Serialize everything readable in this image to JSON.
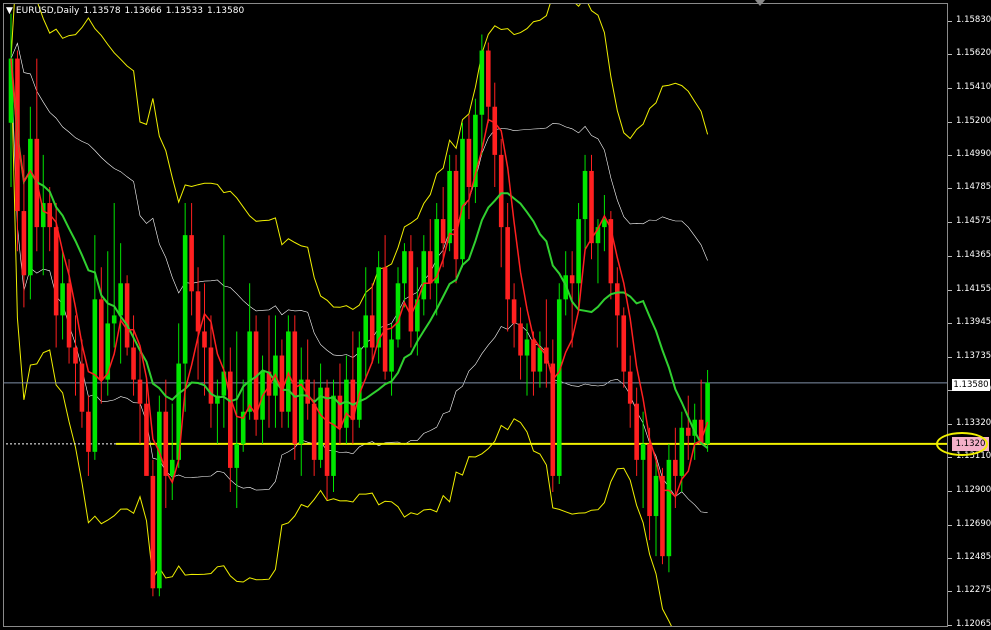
{
  "header": {
    "symbol": "EURUSD,Daily",
    "open": "1.13578",
    "high": "1.13666",
    "low": "1.13533",
    "close": "1.13580"
  },
  "price_axis": {
    "labels": [
      "1.15830",
      "1.15620",
      "1.15410",
      "1.15200",
      "1.14990",
      "1.14785",
      "1.14575",
      "1.14365",
      "1.14155",
      "1.13945",
      "1.13735",
      "1.13530",
      "1.13320",
      "1.13110",
      "1.12900",
      "1.12690",
      "1.12485",
      "1.12275",
      "1.12065"
    ]
  },
  "current_price": "1.13580",
  "horizontal_line_price": "1.1320",
  "colors": {
    "background": "#000000",
    "bull_candle": "#00e600",
    "bear_candle": "#ff2020",
    "bands": "#f0f000",
    "inner_bands": "#ffffff",
    "fast_ma": "#ff2020",
    "slow_ma": "#30d030",
    "horizontal_line": "#f0f000",
    "bid_line": "#8090a8"
  },
  "icons": {
    "menu": "triangle-down-icon",
    "chart_shift": "triangle-down-icon"
  },
  "chart_data": {
    "type": "candlestick",
    "y_range": [
      1.12065,
      1.1594
    ],
    "candles": [
      [
        1.152,
        1.1588,
        1.148,
        1.156
      ],
      [
        1.156,
        1.1565,
        1.144,
        1.1465
      ],
      [
        1.1465,
        1.15,
        1.1405,
        1.1425
      ],
      [
        1.1425,
        1.153,
        1.141,
        1.151
      ],
      [
        1.151,
        1.156,
        1.144,
        1.1455
      ],
      [
        1.1455,
        1.15,
        1.1425,
        1.147
      ],
      [
        1.147,
        1.148,
        1.144,
        1.1455
      ],
      [
        1.1455,
        1.147,
        1.138,
        1.14
      ],
      [
        1.14,
        1.144,
        1.1385,
        1.142
      ],
      [
        1.142,
        1.1435,
        1.137,
        1.138
      ],
      [
        1.138,
        1.14,
        1.135,
        1.137
      ],
      [
        1.137,
        1.1385,
        1.133,
        1.134
      ],
      [
        1.134,
        1.135,
        1.13,
        1.1315
      ],
      [
        1.1315,
        1.145,
        1.131,
        1.141
      ],
      [
        1.141,
        1.143,
        1.1345,
        1.136
      ],
      [
        1.136,
        1.144,
        1.135,
        1.1395
      ],
      [
        1.1395,
        1.147,
        1.138,
        1.14
      ],
      [
        1.14,
        1.1445,
        1.137,
        1.142
      ],
      [
        1.142,
        1.1425,
        1.1375,
        1.138
      ],
      [
        1.138,
        1.14,
        1.135,
        1.136
      ],
      [
        1.136,
        1.138,
        1.132,
        1.1345
      ],
      [
        1.1345,
        1.136,
        1.131,
        1.13
      ],
      [
        1.13,
        1.131,
        1.1225,
        1.123
      ],
      [
        1.123,
        1.135,
        1.1225,
        1.134
      ],
      [
        1.134,
        1.136,
        1.128,
        1.13
      ],
      [
        1.13,
        1.1345,
        1.1285,
        1.131
      ],
      [
        1.131,
        1.1395,
        1.1305,
        1.137
      ],
      [
        1.137,
        1.147,
        1.134,
        1.145
      ],
      [
        1.145,
        1.147,
        1.14,
        1.1415
      ],
      [
        1.1415,
        1.143,
        1.136,
        1.139
      ],
      [
        1.139,
        1.142,
        1.135,
        1.138
      ],
      [
        1.138,
        1.14,
        1.133,
        1.1345
      ],
      [
        1.1345,
        1.136,
        1.132,
        1.135
      ],
      [
        1.135,
        1.145,
        1.133,
        1.1365
      ],
      [
        1.1365,
        1.138,
        1.129,
        1.1305
      ],
      [
        1.1305,
        1.139,
        1.128,
        1.132
      ],
      [
        1.132,
        1.136,
        1.1315,
        1.134
      ],
      [
        1.134,
        1.142,
        1.1335,
        1.139
      ],
      [
        1.139,
        1.14,
        1.1325,
        1.1335
      ],
      [
        1.1335,
        1.1375,
        1.132,
        1.1365
      ],
      [
        1.1365,
        1.14,
        1.133,
        1.135
      ],
      [
        1.135,
        1.14,
        1.133,
        1.1375
      ],
      [
        1.1375,
        1.1385,
        1.133,
        1.134
      ],
      [
        1.134,
        1.14,
        1.133,
        1.139
      ],
      [
        1.139,
        1.14,
        1.131,
        1.132
      ],
      [
        1.132,
        1.138,
        1.13,
        1.136
      ],
      [
        1.136,
        1.1385,
        1.1335,
        1.1345
      ],
      [
        1.1345,
        1.136,
        1.13,
        1.131
      ],
      [
        1.131,
        1.137,
        1.1305,
        1.1355
      ],
      [
        1.1355,
        1.136,
        1.1285,
        1.13
      ],
      [
        1.13,
        1.136,
        1.129,
        1.135
      ],
      [
        1.135,
        1.137,
        1.132,
        1.133
      ],
      [
        1.133,
        1.1375,
        1.132,
        1.136
      ],
      [
        1.136,
        1.139,
        1.132,
        1.1335
      ],
      [
        1.1335,
        1.139,
        1.133,
        1.138
      ],
      [
        1.138,
        1.143,
        1.136,
        1.14
      ],
      [
        1.14,
        1.142,
        1.137,
        1.138
      ],
      [
        1.138,
        1.144,
        1.137,
        1.143
      ],
      [
        1.143,
        1.145,
        1.136,
        1.1365
      ],
      [
        1.1365,
        1.1395,
        1.135,
        1.1385
      ],
      [
        1.1385,
        1.143,
        1.138,
        1.142
      ],
      [
        1.142,
        1.1445,
        1.1405,
        1.144
      ],
      [
        1.144,
        1.145,
        1.138,
        1.139
      ],
      [
        1.139,
        1.143,
        1.1375,
        1.141
      ],
      [
        1.141,
        1.145,
        1.14,
        1.144
      ],
      [
        1.144,
        1.146,
        1.141,
        1.142
      ],
      [
        1.142,
        1.147,
        1.14,
        1.146
      ],
      [
        1.146,
        1.148,
        1.143,
        1.1445
      ],
      [
        1.1445,
        1.15,
        1.144,
        1.149
      ],
      [
        1.149,
        1.15,
        1.142,
        1.1435
      ],
      [
        1.1435,
        1.152,
        1.143,
        1.151
      ],
      [
        1.151,
        1.1525,
        1.146,
        1.148
      ],
      [
        1.148,
        1.1535,
        1.147,
        1.1525
      ],
      [
        1.1525,
        1.1575,
        1.15,
        1.1565
      ],
      [
        1.1565,
        1.157,
        1.152,
        1.153
      ],
      [
        1.153,
        1.1545,
        1.148,
        1.15
      ],
      [
        1.15,
        1.151,
        1.143,
        1.1455
      ],
      [
        1.1455,
        1.147,
        1.139,
        1.141
      ],
      [
        1.141,
        1.142,
        1.138,
        1.1395
      ],
      [
        1.1395,
        1.1405,
        1.136,
        1.1375
      ],
      [
        1.1375,
        1.1395,
        1.135,
        1.1385
      ],
      [
        1.1385,
        1.139,
        1.135,
        1.1365
      ],
      [
        1.1365,
        1.139,
        1.1355,
        1.138
      ],
      [
        1.138,
        1.141,
        1.1355,
        1.137
      ],
      [
        1.137,
        1.1385,
        1.129,
        1.13
      ],
      [
        1.13,
        1.142,
        1.1295,
        1.141
      ],
      [
        1.141,
        1.144,
        1.14,
        1.1425
      ],
      [
        1.1425,
        1.144,
        1.138,
        1.142
      ],
      [
        1.142,
        1.147,
        1.1405,
        1.146
      ],
      [
        1.146,
        1.15,
        1.144,
        1.149
      ],
      [
        1.149,
        1.15,
        1.1435,
        1.1445
      ],
      [
        1.1445,
        1.146,
        1.142,
        1.1455
      ],
      [
        1.1455,
        1.1475,
        1.144,
        1.146
      ],
      [
        1.146,
        1.1465,
        1.141,
        1.142
      ],
      [
        1.142,
        1.143,
        1.138,
        1.14
      ],
      [
        1.14,
        1.1405,
        1.1355,
        1.1365
      ],
      [
        1.1365,
        1.1375,
        1.133,
        1.1345
      ],
      [
        1.1345,
        1.1355,
        1.13,
        1.131
      ],
      [
        1.131,
        1.134,
        1.128,
        1.132
      ],
      [
        1.132,
        1.133,
        1.126,
        1.1275
      ],
      [
        1.1275,
        1.131,
        1.125,
        1.13
      ],
      [
        1.13,
        1.1305,
        1.1245,
        1.125
      ],
      [
        1.125,
        1.132,
        1.124,
        1.131
      ],
      [
        1.131,
        1.133,
        1.128,
        1.13
      ],
      [
        1.13,
        1.134,
        1.129,
        1.133
      ],
      [
        1.133,
        1.135,
        1.131,
        1.1325
      ],
      [
        1.1325,
        1.1345,
        1.131,
        1.1335
      ],
      [
        1.1335,
        1.136,
        1.132,
        1.132
      ],
      [
        1.132,
        1.1366,
        1.1315,
        1.1358
      ]
    ]
  }
}
